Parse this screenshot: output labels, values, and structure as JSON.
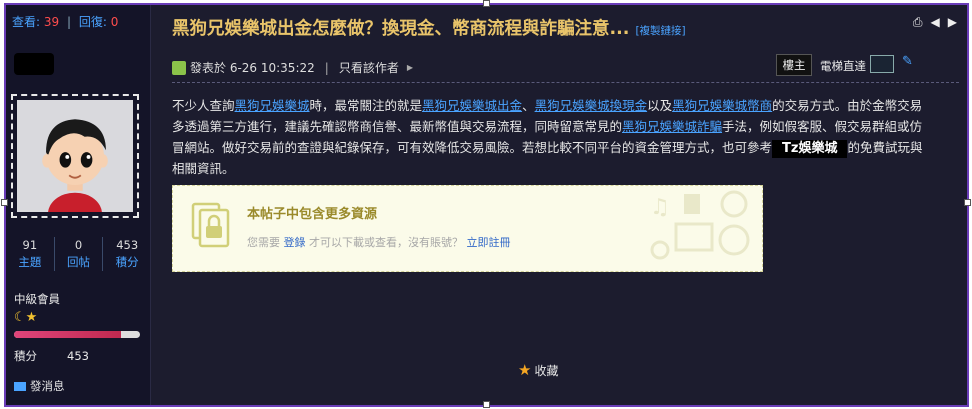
{
  "stats": {
    "views_label": "查看:",
    "views": "39",
    "replies_label": "回復:",
    "replies": "0"
  },
  "profile": {
    "counts": [
      {
        "value": "91",
        "label": "主題"
      },
      {
        "value": "0",
        "label": "回帖"
      },
      {
        "value": "453",
        "label": "積分"
      }
    ],
    "level": "中級會員",
    "progress": 0.85,
    "score_label": "積分",
    "score": "453",
    "message": "發消息"
  },
  "post": {
    "title": "黑狗兄娛樂城出金怎麼做？換現金、幣商流程與詐騙注意...",
    "copy_link": "[複製鏈接]",
    "posted": "發表於 6-26 10:35:22",
    "only_author": "只看該作者",
    "floor": "樓主",
    "jump_label": "電梯直達",
    "body": {
      "p1": "不少人查詢",
      "l1": "黑狗兄娛樂城",
      "p2": "時，最常關注的就是",
      "l2": "黑狗兄娛樂城出金",
      "p3": "、",
      "l3": "黑狗兄娛樂城換現金",
      "p4": "以及",
      "l4": "黑狗兄娛樂城幣商",
      "p5": "的交易方式。由於金幣交易多透過第三方進行，建議先確認幣商信譽、最新幣值與交易流程，同時留意常見的",
      "l5": "黑狗兄娛樂城詐騙",
      "p6": "手法，例如假客服、假交易群組或仿冒網站。做好交易前的查證與紀錄保存，可有效降低交易風險。若想比較不同平台的資金管理方式，也可參考",
      "brand": "Tz娛樂城",
      "p7": "的免費試玩與相關資訊。"
    },
    "locked": {
      "title": "本帖子中包含更多資源",
      "need": "您需要",
      "login": "登錄",
      "after": "才可以下載或查看，沒有賬號？",
      "register": "立即註冊"
    },
    "favorite": "收藏"
  }
}
